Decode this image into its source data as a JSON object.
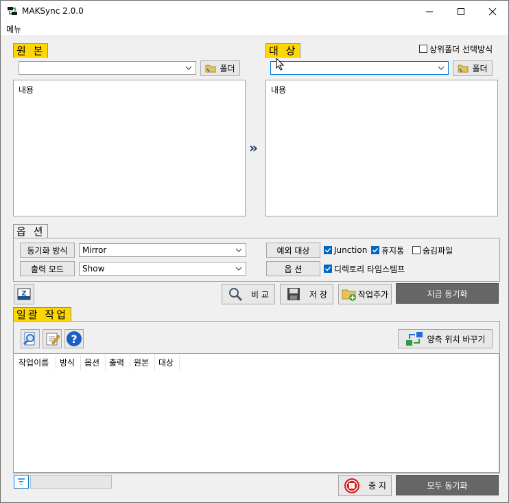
{
  "window": {
    "title": "MAKSync 2.0.0"
  },
  "menu": {
    "label": "메뉴"
  },
  "source": {
    "header": "원 본",
    "path_value": "",
    "folder_button": "폴더",
    "content_text": "내용"
  },
  "target": {
    "header": "대 상",
    "path_value": "",
    "folder_button": "폴더",
    "content_text": "내용",
    "parent_folder_option": "상위폴더 선택방식",
    "parent_folder_checked": false
  },
  "direction_arrow": "»",
  "options": {
    "header": "옵 션",
    "sync_mode_button": "동기화 방식",
    "sync_mode_value": "Mirror",
    "output_mode_button": "출력 모드",
    "output_mode_value": "Show",
    "exclude_button": "예외 대상",
    "option_button": "옵 션",
    "checkboxes": [
      {
        "label": "Junction",
        "checked": true
      },
      {
        "label": "휴지통",
        "checked": true
      },
      {
        "label": "숨김파일",
        "checked": false
      },
      {
        "label": "디렉토리 타임스템프",
        "checked": true
      }
    ]
  },
  "actions": {
    "compare": "비 교",
    "save": "저 장",
    "add_job": "작업추가",
    "sync_now": "지금 동기화"
  },
  "batch": {
    "header": "일괄 작업",
    "swap_button": "양측 위치 바꾸기",
    "columns": [
      "작업이름",
      "방식",
      "옵션",
      "출력",
      "원본",
      "대상"
    ],
    "stop_button": "중 지",
    "sync_all": "모두 동기화"
  },
  "colors": {
    "header_yellow": "#ffd600",
    "dark_button": "#666666",
    "accent_blue": "#0067c0"
  }
}
